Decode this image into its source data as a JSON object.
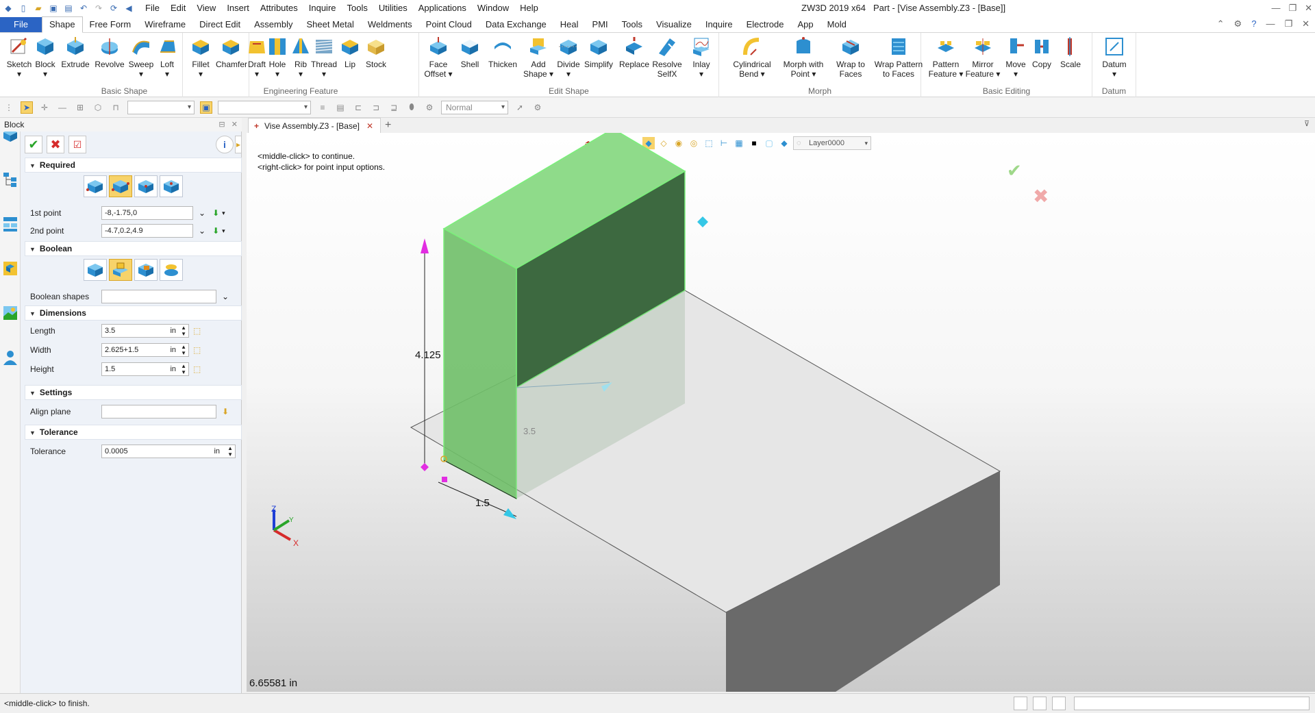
{
  "titlebar": {
    "menus": [
      "File",
      "Edit",
      "View",
      "Insert",
      "Attributes",
      "Inquire",
      "Tools",
      "Utilities",
      "Applications",
      "Window",
      "Help"
    ],
    "app_title": "ZW3D 2019  x64",
    "doc_title": "Part - [Vise Assembly.Z3 - [Base]]"
  },
  "ribbon_tabs": {
    "file": "File",
    "tabs": [
      "Shape",
      "Free Form",
      "Wireframe",
      "Direct Edit",
      "Assembly",
      "Sheet Metal",
      "Weldments",
      "Point Cloud",
      "Data Exchange",
      "Heal",
      "PMI",
      "Tools",
      "Visualize",
      "Inquire",
      "Electrode",
      "App",
      "Mold"
    ],
    "active": "Shape"
  },
  "ribbon": {
    "groups": [
      {
        "label": "Basic Shape",
        "buttons": [
          {
            "l1": "Sketch",
            "l2": "▾"
          },
          {
            "l1": "Block",
            "l2": "▾"
          },
          {
            "l1": "Extrude",
            "l2": ""
          },
          {
            "l1": "Revolve",
            "l2": ""
          },
          {
            "l1": "Sweep",
            "l2": "▾"
          },
          {
            "l1": "Loft",
            "l2": "▾"
          }
        ]
      },
      {
        "label": "Engineering Feature",
        "buttons": [
          {
            "l1": "Fillet",
            "l2": "▾"
          },
          {
            "l1": "Chamfer",
            "l2": ""
          },
          {
            "l1": "Draft",
            "l2": "▾"
          },
          {
            "l1": "Hole",
            "l2": "▾"
          },
          {
            "l1": "Rib",
            "l2": "▾"
          },
          {
            "l1": "Thread",
            "l2": "▾"
          },
          {
            "l1": "Lip",
            "l2": ""
          },
          {
            "l1": "Stock",
            "l2": ""
          }
        ]
      },
      {
        "label": "Edit Shape",
        "buttons": [
          {
            "l1": "Face",
            "l2": "Offset ▾"
          },
          {
            "l1": "Shell",
            "l2": ""
          },
          {
            "l1": "Thicken",
            "l2": ""
          },
          {
            "l1": "Add",
            "l2": "Shape ▾"
          },
          {
            "l1": "Divide",
            "l2": "▾"
          },
          {
            "l1": "Simplify",
            "l2": ""
          },
          {
            "l1": "Replace",
            "l2": ""
          },
          {
            "l1": "Resolve",
            "l2": "SelfX"
          },
          {
            "l1": "Inlay",
            "l2": "▾"
          }
        ]
      },
      {
        "label": "Morph",
        "buttons": [
          {
            "l1": "Cylindrical",
            "l2": "Bend ▾"
          },
          {
            "l1": "Morph with",
            "l2": "Point ▾"
          },
          {
            "l1": "Wrap to",
            "l2": "Faces"
          },
          {
            "l1": "Wrap Pattern",
            "l2": "to Faces"
          }
        ]
      },
      {
        "label": "Basic Editing",
        "buttons": [
          {
            "l1": "Pattern",
            "l2": "Feature ▾"
          },
          {
            "l1": "Mirror",
            "l2": "Feature ▾"
          },
          {
            "l1": "Move",
            "l2": "▾"
          },
          {
            "l1": "Copy",
            "l2": ""
          },
          {
            "l1": "Scale",
            "l2": ""
          }
        ]
      },
      {
        "label": "Datum",
        "buttons": [
          {
            "l1": "Datum",
            "l2": "▾"
          }
        ]
      }
    ]
  },
  "toolbar2": {
    "style_combo": "Normal"
  },
  "panel": {
    "title": "Block",
    "sections": {
      "required": "Required",
      "boolean": "Boolean",
      "dimensions": "Dimensions",
      "settings": "Settings",
      "tolerance": "Tolerance"
    },
    "fields": {
      "p1_label": "1st point",
      "p1_value": "-8,-1.75,0",
      "p2_label": "2nd point",
      "p2_value": "-4.7,0.2,4.9",
      "bool_label": "Boolean shapes",
      "bool_value": "",
      "length_label": "Length",
      "length_value": "3.5",
      "length_unit": "in",
      "width_label": "Width",
      "width_value": "2.625+1.5",
      "width_unit": "in",
      "height_label": "Height",
      "height_value": "1.5",
      "height_unit": "in",
      "align_label": "Align plane",
      "align_value": "",
      "tol_label": "Tolerance",
      "tol_value": "0.0005",
      "tol_unit": "in"
    }
  },
  "doc_tab": {
    "label": "Vise Assembly.Z3 - [Base]"
  },
  "viewport": {
    "prompt1": "<middle-click> to continue.",
    "prompt2": "<right-click> for point input options.",
    "coord_readout": "6.65581 in",
    "layer": "Layer0000",
    "dim_height": "4.125",
    "dim_length": "3.5",
    "dim_width": "1.5",
    "axis_x": "X",
    "axis_y": "Y",
    "axis_z": "Z"
  },
  "colors": {
    "accent_blue": "#2b64c4",
    "block_top": "#8fdb8a",
    "block_front": "#6fbf68",
    "block_side": "#3d6940",
    "ok_green": "#2aa52a",
    "cancel_red": "#d62b2b",
    "selected_yellow": "#f7d36a"
  },
  "statusbar": {
    "message": "<middle-click> to finish."
  }
}
